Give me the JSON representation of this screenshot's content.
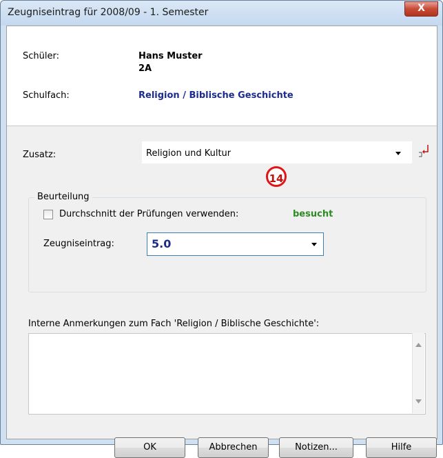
{
  "window": {
    "title": "Zeugniseintrag für 2008/09 - 1. Semester",
    "close_label": "X"
  },
  "student": {
    "label": "Schüler:",
    "name": "Hans Muster",
    "class": "2A"
  },
  "subject": {
    "label": "Schulfach:",
    "value": "Religion / Biblische Geschichte"
  },
  "addition": {
    "label": "Zusatz:",
    "value": "Religion und Kultur",
    "annotation_marker": "14",
    "side_icon": "insert-return-icon"
  },
  "assessment": {
    "group_label": "Beurteilung",
    "checkbox_label": "Durchschnitt der Prüfungen verwenden:",
    "checkbox_checked": false,
    "status": "besucht",
    "entry_label": "Zeugniseintrag:",
    "entry_value": "5.0"
  },
  "notes": {
    "label": "Interne Anmerkungen zum Fach 'Religion / Biblische Geschichte':",
    "value": ""
  },
  "buttons": {
    "ok": "OK",
    "cancel": "Abbrechen",
    "notes": "Notizen...",
    "help": "Hilfe"
  },
  "colors": {
    "accent_blue": "#1c2c8c",
    "status_green": "#2e8b24",
    "marker_red": "#e01616"
  }
}
